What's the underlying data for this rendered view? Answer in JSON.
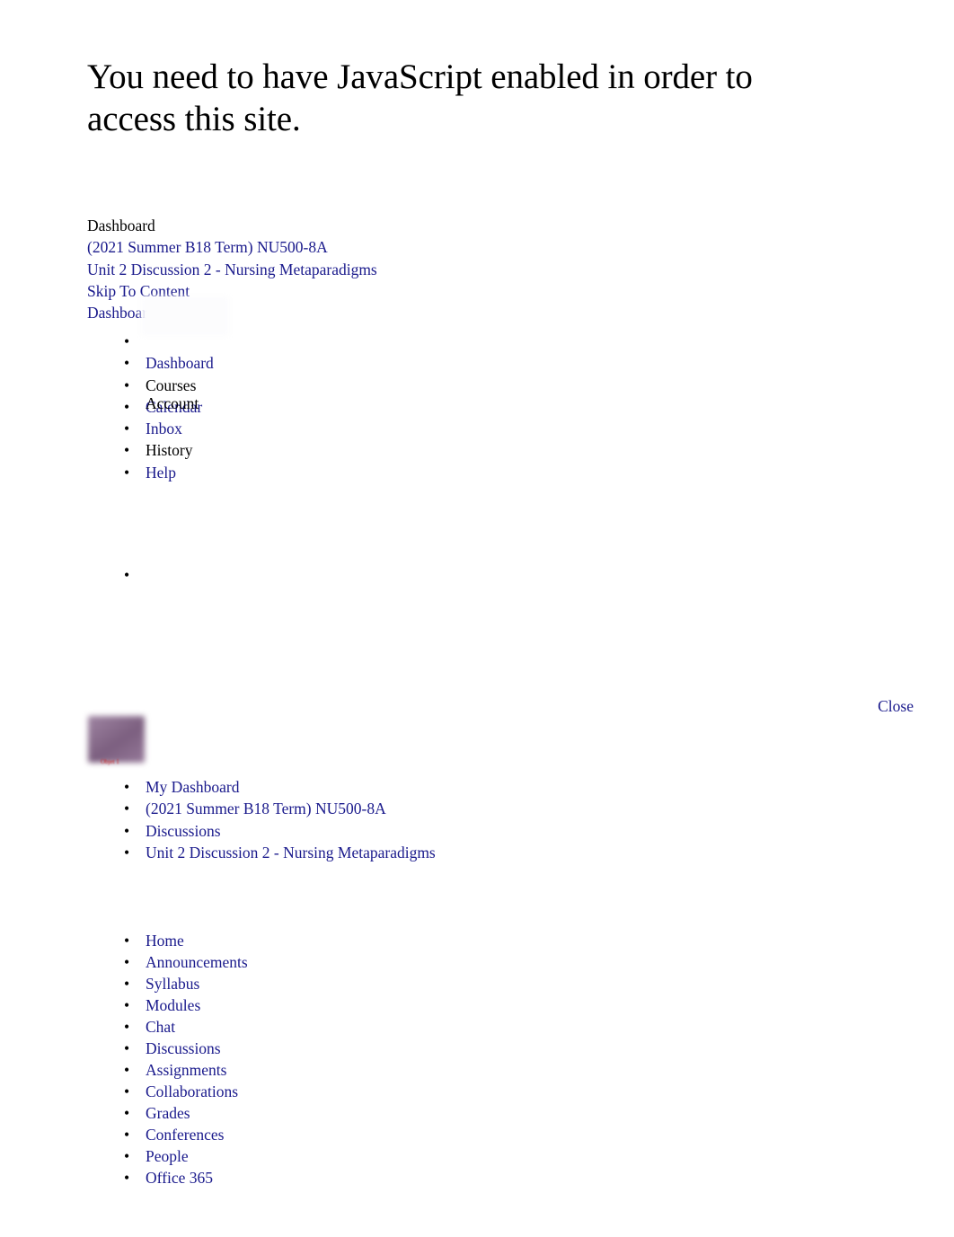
{
  "page": {
    "background_color": "#ffffff",
    "link_color": "#1a1a8c",
    "text_color": "#000000",
    "broken_object_color": "#8a6a8e",
    "broken_object_label_color": "#cc2222"
  },
  "heading": {
    "text": "You need to have JavaScript enabled in order to access this site."
  },
  "breadcrumb_top": {
    "items": [
      {
        "label": "Dashboard",
        "is_link": false
      },
      {
        "label": "(2021 Summer B18 Term) NU500-8A",
        "is_link": true
      },
      {
        "label": "Unit 2 Discussion 2 - Nursing Metaparadigms",
        "is_link": true
      },
      {
        "label": "Skip To Content",
        "is_link": true
      },
      {
        "label": "Dashboard",
        "is_link": true
      }
    ]
  },
  "global_nav": {
    "avatar_name": "user-avatar-placeholder",
    "account_label": "Account",
    "items": [
      {
        "label": "",
        "is_link": false,
        "name": "sidebar-item-avatar"
      },
      {
        "label": "Dashboard",
        "is_link": true,
        "name": "sidebar-item-dashboard"
      },
      {
        "label": "Courses",
        "is_link": false,
        "name": "sidebar-item-courses"
      },
      {
        "label": "Calendar",
        "is_link": true,
        "name": "sidebar-item-calendar"
      },
      {
        "label": "Inbox",
        "is_link": true,
        "name": "sidebar-item-inbox"
      },
      {
        "label": "History",
        "is_link": false,
        "name": "sidebar-item-history"
      },
      {
        "label": "Help",
        "is_link": true,
        "name": "sidebar-item-help"
      }
    ],
    "trailing_empty_item": ""
  },
  "tray": {
    "close_label": "Close",
    "broken_object_label": "Objet 1"
  },
  "course_breadcrumbs": {
    "items": [
      {
        "label": "My Dashboard",
        "is_link": true
      },
      {
        "label": "(2021 Summer B18 Term) NU500-8A",
        "is_link": true
      },
      {
        "label": "Discussions",
        "is_link": true
      },
      {
        "label": "Unit 2 Discussion 2 - Nursing Metaparadigms",
        "is_link": true
      }
    ]
  },
  "course_nav": {
    "items": [
      {
        "label": "Home"
      },
      {
        "label": "Announcements"
      },
      {
        "label": "Syllabus"
      },
      {
        "label": "Modules"
      },
      {
        "label": "Chat"
      },
      {
        "label": "Discussions"
      },
      {
        "label": "Assignments"
      },
      {
        "label": "Collaborations"
      },
      {
        "label": "Grades"
      },
      {
        "label": "Conferences"
      },
      {
        "label": "People"
      },
      {
        "label": "Office 365"
      }
    ]
  }
}
